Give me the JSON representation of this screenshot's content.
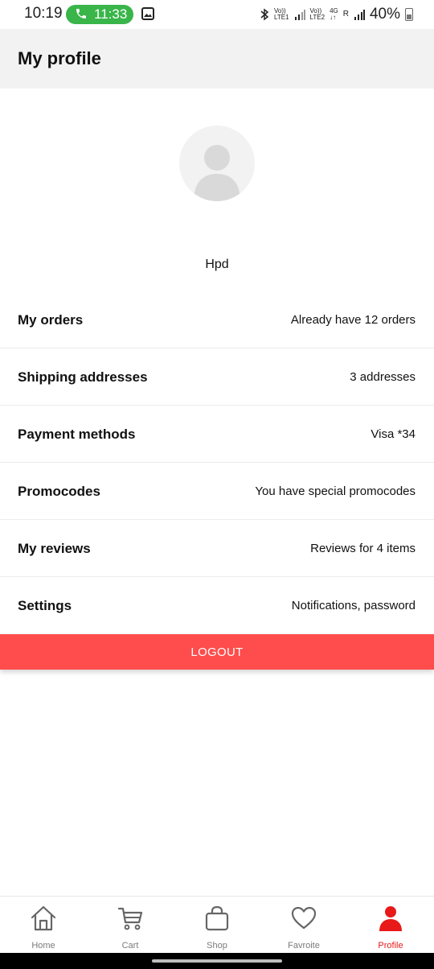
{
  "status_bar": {
    "time": "10:19",
    "call_time": "11:33",
    "net1_top": "Vo))",
    "net1_bottom": "LTE1",
    "net2_top": "Vo))",
    "net2_bottom": "LTE2",
    "net_type": "4G",
    "roaming": "R",
    "battery": "40%"
  },
  "header": {
    "title": "My profile"
  },
  "profile": {
    "name": "Hpd"
  },
  "menu": [
    {
      "label": "My orders",
      "value": "Already have 12 orders"
    },
    {
      "label": "Shipping addresses",
      "value": "3 addresses"
    },
    {
      "label": "Payment methods",
      "value": "Visa *34"
    },
    {
      "label": "Promocodes",
      "value": "You have special promocodes"
    },
    {
      "label": "My reviews",
      "value": "Reviews for 4 items"
    },
    {
      "label": "Settings",
      "value": "Notifications, password"
    }
  ],
  "logout_label": "LOGOUT",
  "nav": [
    {
      "label": "Home",
      "icon": "home-icon",
      "active": false
    },
    {
      "label": "Cart",
      "icon": "cart-icon",
      "active": false
    },
    {
      "label": "Shop",
      "icon": "shopping-bag-icon",
      "active": false
    },
    {
      "label": "Favroite",
      "icon": "heart-icon",
      "active": false
    },
    {
      "label": "Profile",
      "icon": "person-icon",
      "active": true
    }
  ],
  "colors": {
    "accent": "#ff4c4c",
    "active_nav": "#e81919",
    "call_pill": "#39b54a",
    "header_bg": "#f2f2f2"
  }
}
